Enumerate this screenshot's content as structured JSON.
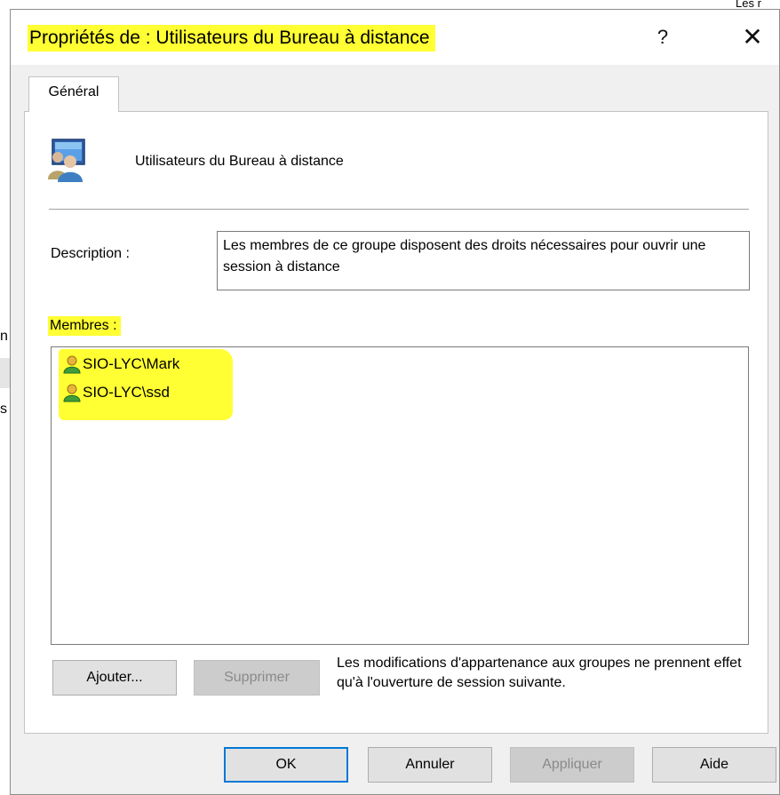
{
  "background": {
    "fragment_top": "Les r",
    "fragment_1": "n",
    "fragment_2": "s"
  },
  "dialog": {
    "title": "Propriétés de : Utilisateurs du Bureau à distance",
    "help_glyph": "?",
    "close_glyph": "✕",
    "tab_label": "Général",
    "group_name": "Utilisateurs du Bureau à distance",
    "group_icon": "users-group-icon",
    "description_label": "Description :",
    "description_value": "Les membres de ce groupe disposent des droits nécessaires pour ouvrir une session à distance",
    "members_label": "Membres :",
    "members": [
      {
        "name": "SIO-LYC\\Mark",
        "icon": "user-icon"
      },
      {
        "name": "SIO-LYC\\ssd",
        "icon": "user-icon"
      }
    ],
    "add_button": "Ajouter...",
    "remove_button": "Supprimer",
    "note": "Les modifications d'appartenance aux groupes ne prennent effet qu'à l'ouverture de session suivante.",
    "ok_button": "OK",
    "cancel_button": "Annuler",
    "apply_button": "Appliquer",
    "help_button": "Aide"
  },
  "colors": {
    "highlight": "#ffff33",
    "dialog_bg": "#f0f0f0",
    "accent": "#0078d7"
  }
}
